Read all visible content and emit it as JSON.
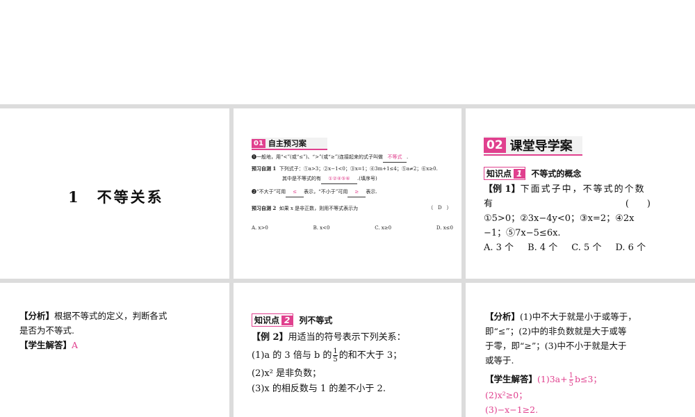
{
  "panel1": {
    "title": "1　不等关系"
  },
  "panel2": {
    "section_num": "01",
    "section_title": "自主预习案",
    "line1_pre": "❶一般地，用“<”(或“≤”)、“>”(或“≥”)连接起来的式子叫做",
    "line1_answer": "不等式",
    "line1_post": ".",
    "q1_label": "预习自测 1",
    "q1_text": "下列式子：①a>3；②x−1<0；③x=1；④3m+1≤4；⑤a≠2；⑥x≥0.",
    "q1_text2_pre": "其中是不等式的有",
    "q1_answer": "①②④⑤⑥",
    "q1_text2_post": ".(填序号)",
    "line2_pre": "❷“不大于”可用",
    "line2_ans1": "≤",
    "line2_mid": "表示，“不小于”可用",
    "line2_ans2": "≥",
    "line2_post": "表示.",
    "q2_label": "预习自测 2",
    "q2_text": "如果 x 是非正数，则用不等式表示为",
    "q2_answer": "（　D　）",
    "options": [
      "A. x>0",
      "B. x<0",
      "C. x≥0",
      "D. x≤0"
    ]
  },
  "panel3": {
    "section_num": "02",
    "section_title": "课堂导学案",
    "kp_label": "知识点",
    "kp_num": "1",
    "kp_title": "不等式的概念",
    "ex_label": "【例 1】",
    "ex_line1": "下面式子中，不等式的个数",
    "ex_line2": "有",
    "ex_paren": "(　　)",
    "ex_line3": "①5>0；②3x−4y<0；③x=2；④2x",
    "ex_line4": "−1；⑤7x−5≤6x.",
    "options": [
      "A. 3 个",
      "B. 4 个",
      "C. 5 个",
      "D. 6 个"
    ]
  },
  "panel4": {
    "analysis_label": "【分析】",
    "analysis_line1": "根据不等式的定义，判断各式",
    "analysis_line2": "是否为不等式.",
    "answer_label": "【学生解答】",
    "answer": "A"
  },
  "panel5": {
    "kp_label": "知识点",
    "kp_num": "2",
    "kp_title": "列不等式",
    "ex_label": "【例 2】",
    "ex_text": "用适当的符号表示下列关系：",
    "item1_pre": "(1)a 的 3 倍与 b 的",
    "item1_num": "1",
    "item1_den": "5",
    "item1_post": "的和不大于 3；",
    "item2": "(2)x² 是非负数；",
    "item3": "(3)x 的相反数与 1 的差不小于 2."
  },
  "panel6": {
    "analysis_label": "【分析】",
    "analysis_line1": "(1)中不大于就是小于或等于，",
    "analysis_line2": "即“≤”；(2)中的非负数就是大于或等",
    "analysis_line3": "于零，即“≥”；(3)中不小于就是大于",
    "analysis_line4": "或等于.",
    "answer_label": "【学生解答】",
    "ans1_pre": "(1)3a+",
    "ans1_num": "1",
    "ans1_den": "5",
    "ans1_post": "b≤3；",
    "ans2": "(2)x²≥0；",
    "ans3": "(3)−x−1≥2."
  }
}
